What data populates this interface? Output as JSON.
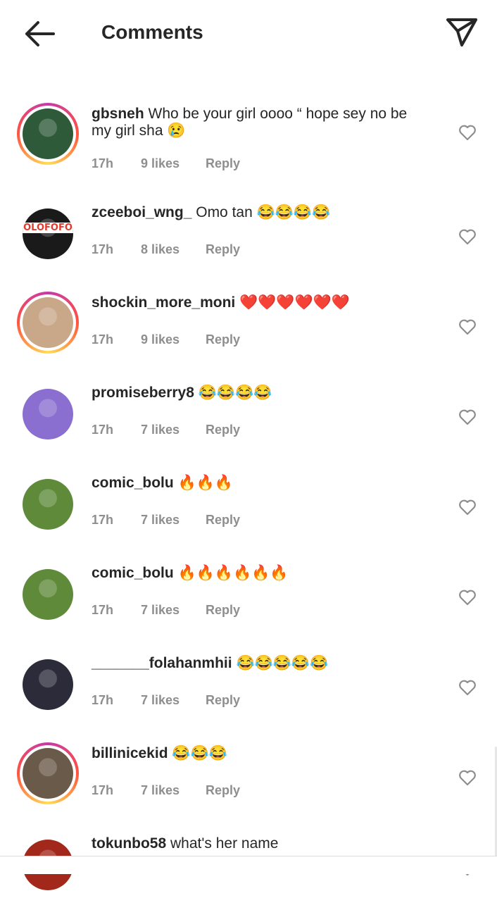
{
  "header": {
    "title": "Comments"
  },
  "comments": [
    {
      "username": "gbsneh",
      "text": "Who be your girl oooo “ hope sey no be my girl sha 😢",
      "time": "17h",
      "likes": "9 likes",
      "reply": "Reply",
      "story_ring": true,
      "avatar_color": "#2f5a3a"
    },
    {
      "username": "zceeboi_wng_",
      "text": "Omo tan 😂😂😂😂",
      "time": "17h",
      "likes": "8 likes",
      "reply": "Reply",
      "story_ring": false,
      "avatar_color": "#1a1a1a",
      "avatar_label": "OLOFOFO"
    },
    {
      "username": "shockin_more_moni",
      "text": "❤️❤️❤️❤️❤️❤️",
      "time": "17h",
      "likes": "9 likes",
      "reply": "Reply",
      "story_ring": true,
      "avatar_color": "#c9a88a"
    },
    {
      "username": "promiseberry8",
      "text": "😂😂😂😂",
      "time": "17h",
      "likes": "7 likes",
      "reply": "Reply",
      "story_ring": false,
      "avatar_color": "#8a6fd0"
    },
    {
      "username": "comic_bolu",
      "text": "🔥🔥🔥",
      "time": "17h",
      "likes": "7 likes",
      "reply": "Reply",
      "story_ring": false,
      "avatar_color": "#5e8a3a"
    },
    {
      "username": "comic_bolu",
      "text": "🔥🔥🔥🔥🔥🔥",
      "time": "17h",
      "likes": "7 likes",
      "reply": "Reply",
      "story_ring": false,
      "avatar_color": "#5e8a3a"
    },
    {
      "username": "_______folahanmhii",
      "text": "😂😂😂😂😂",
      "time": "17h",
      "likes": "7 likes",
      "reply": "Reply",
      "story_ring": false,
      "avatar_color": "#2b2b3a"
    },
    {
      "username": "billinicekid",
      "text": "😂😂😂",
      "time": "17h",
      "likes": "7 likes",
      "reply": "Reply",
      "story_ring": true,
      "avatar_color": "#6a5a4a"
    },
    {
      "username": "tokunbo58",
      "text": "what's her name",
      "time": "",
      "likes": "",
      "reply": "",
      "story_ring": false,
      "avatar_color": "#a3281c"
    }
  ]
}
